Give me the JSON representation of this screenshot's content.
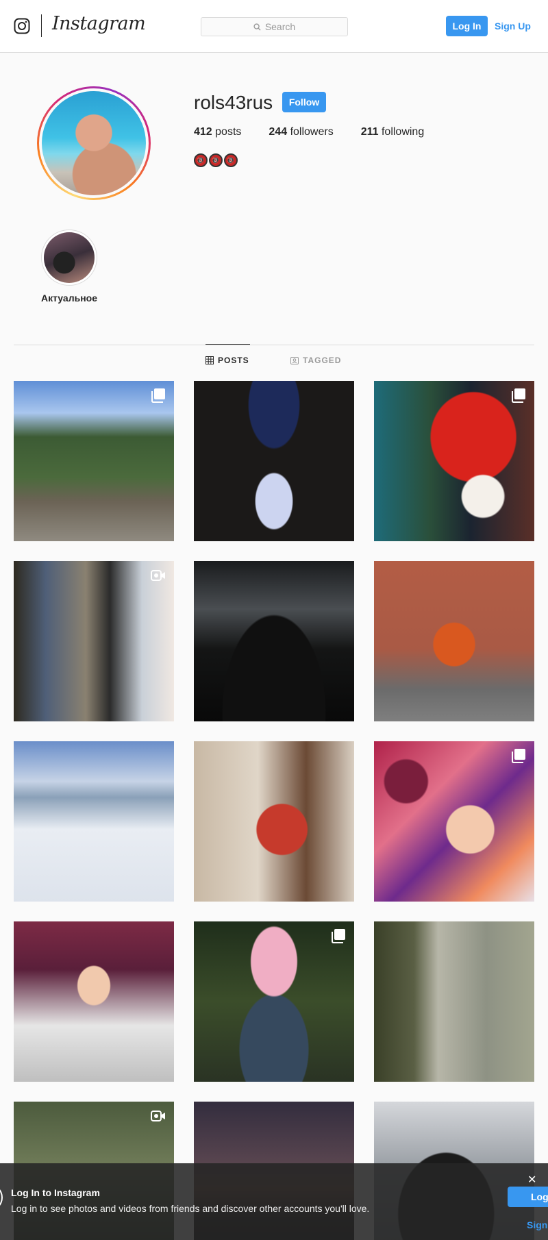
{
  "header": {
    "brand": "Instagram",
    "search_placeholder": "Search",
    "login_label": "Log In",
    "signup_label": "Sign Up"
  },
  "profile": {
    "username": "rols43rus",
    "follow_label": "Follow",
    "stats": {
      "posts_count": "412",
      "posts_label": "posts",
      "followers_count": "244",
      "followers_label": "followers",
      "following_count": "211",
      "following_label": "following"
    },
    "bio_emoji": [
      "🔞",
      "🔞",
      "🔞"
    ]
  },
  "highlights": [
    {
      "label": "Актуальное"
    }
  ],
  "tabs": [
    {
      "label": "POSTS",
      "icon": "grid-icon",
      "active": true
    },
    {
      "label": "TAGGED",
      "icon": "tagged-icon",
      "active": false
    }
  ],
  "posts": [
    {
      "badge": "carousel"
    },
    {
      "badge": ""
    },
    {
      "badge": "carousel"
    },
    {
      "badge": "video"
    },
    {
      "badge": ""
    },
    {
      "badge": ""
    },
    {
      "badge": ""
    },
    {
      "badge": ""
    },
    {
      "badge": "carousel"
    },
    {
      "badge": ""
    },
    {
      "badge": "carousel"
    },
    {
      "badge": ""
    },
    {
      "badge": "video"
    },
    {
      "badge": ""
    },
    {
      "badge": ""
    }
  ],
  "login_banner": {
    "title": "Log In to Instagram",
    "text": "Log in to see photos and videos from friends and discover other accounts you'll love.",
    "close_label": "✕",
    "login_label": "Log",
    "signup_label": "Sign"
  },
  "colors": {
    "accent": "#3897f0",
    "text": "#262626",
    "border": "#dbdbdb",
    "background": "#fafafa"
  }
}
